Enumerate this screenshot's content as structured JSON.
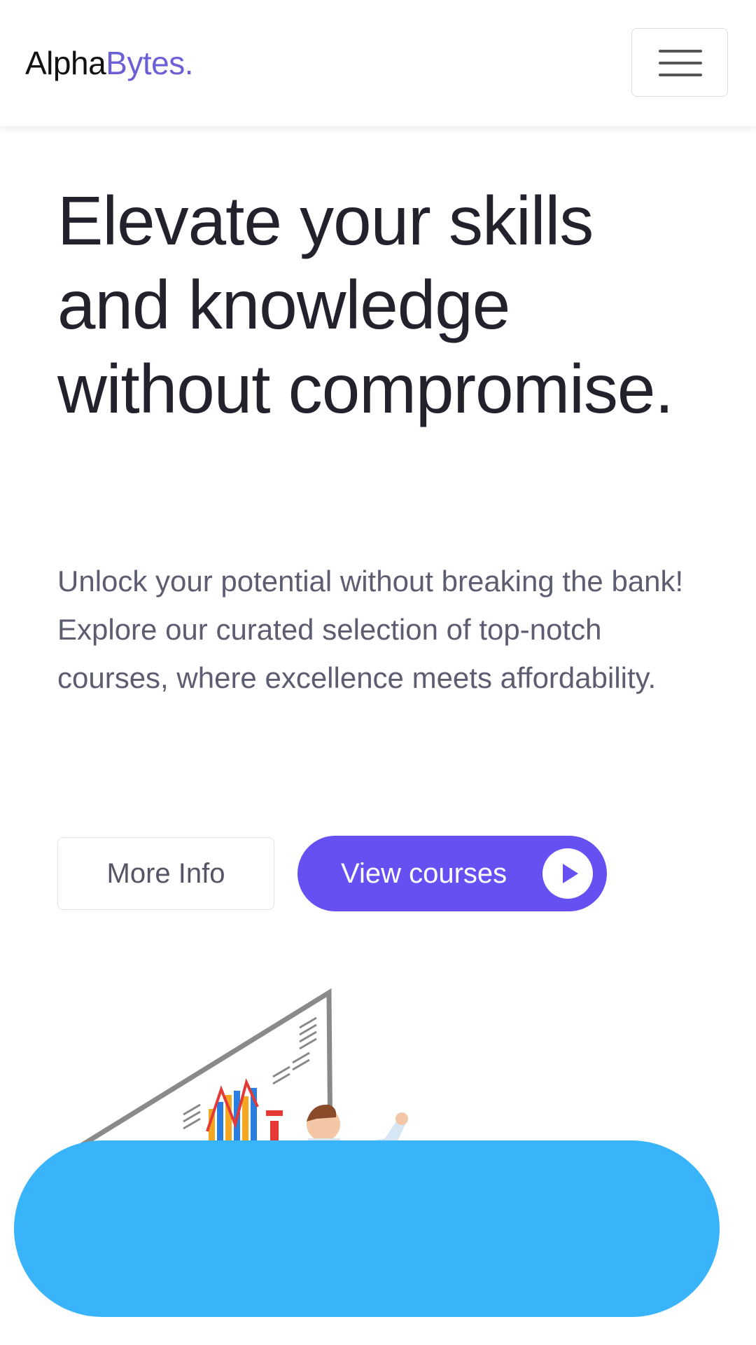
{
  "navbar": {
    "brand_part1": "Alpha",
    "brand_part2": "Bytes.",
    "brand_accent_color": "#6c5fd6",
    "menu_icon": "hamburger-menu-icon"
  },
  "hero": {
    "title": "Elevate your skills and knowledge without compromise.",
    "description": "Unlock your potential without breaking the bank! Explore our curated selection of top-notch courses, where excellence meets affordability.",
    "more_info_label": "More Info",
    "view_courses_label": "View courses",
    "view_courses_icon": "play-icon",
    "primary_color": "#6750f2"
  },
  "overlay": {
    "color": "#39b4fb"
  }
}
